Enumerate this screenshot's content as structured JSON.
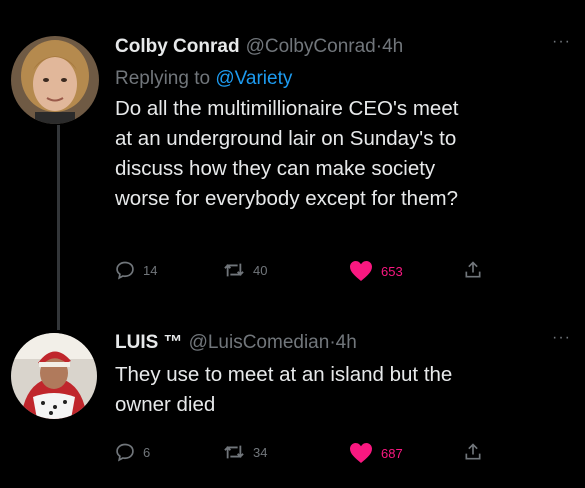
{
  "tweets": [
    {
      "name": "Colby Conrad",
      "handle": "@ColbyConrad",
      "separator": "·",
      "time": "4h",
      "more": "···",
      "replying_prefix": "Replying to ",
      "replying_to": "@Variety",
      "text_lines": [
        "Do all the multimillionaire CEO's meet",
        "at an underground lair on Sunday's to",
        "discuss how they can make society",
        "worse for everybody except for them?"
      ],
      "replies": "14",
      "retweets": "40",
      "likes": "653"
    },
    {
      "name": "LUIS ™",
      "handle": "@LuisComedian",
      "separator": "·",
      "time": "4h",
      "more": "···",
      "text_lines": [
        "They use to meet at an island but the",
        "owner died"
      ],
      "replies": "6",
      "retweets": "34",
      "likes": "687"
    }
  ],
  "colors": {
    "background": "#000000",
    "text": "#e7e9ea",
    "muted": "#71767b",
    "mention": "#1d9bf0",
    "like": "#f91880"
  },
  "icons": [
    "reply-icon",
    "retweet-icon",
    "heart-icon",
    "share-icon",
    "more-icon"
  ]
}
